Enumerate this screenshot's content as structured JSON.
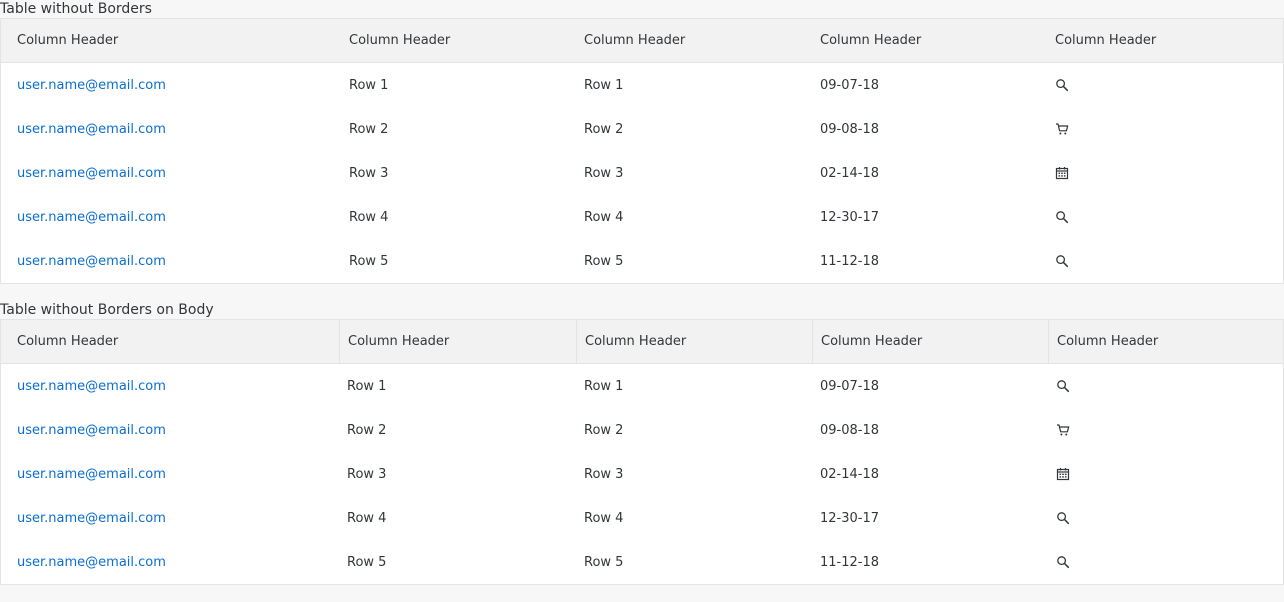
{
  "tables": [
    {
      "title": "Table without Borders",
      "headers": [
        "Column Header",
        "Column Header",
        "Column Header",
        "Column Header",
        "Column Header"
      ],
      "rows": [
        {
          "email": "user.name@email.com",
          "col2": "Row 1",
          "col3": "Row 1",
          "date": "09-07-18",
          "icon": "search-icon"
        },
        {
          "email": "user.name@email.com",
          "col2": "Row 2",
          "col3": "Row 2",
          "date": "09-08-18",
          "icon": "cart-icon"
        },
        {
          "email": "user.name@email.com",
          "col2": "Row 3",
          "col3": "Row 3",
          "date": "02-14-18",
          "icon": "calendar-icon"
        },
        {
          "email": "user.name@email.com",
          "col2": "Row 4",
          "col3": "Row 4",
          "date": "12-30-17",
          "icon": "search-icon"
        },
        {
          "email": "user.name@email.com",
          "col2": "Row 5",
          "col3": "Row 5",
          "date": "11-12-18",
          "icon": "search-icon"
        }
      ]
    },
    {
      "title": "Table without Borders on Body",
      "headers": [
        "Column Header",
        "Column Header",
        "Column Header",
        "Column Header",
        "Column Header"
      ],
      "rows": [
        {
          "email": "user.name@email.com",
          "col2": "Row 1",
          "col3": "Row 1",
          "date": "09-07-18",
          "icon": "search-icon"
        },
        {
          "email": "user.name@email.com",
          "col2": "Row 2",
          "col3": "Row 2",
          "date": "09-08-18",
          "icon": "cart-icon"
        },
        {
          "email": "user.name@email.com",
          "col2": "Row 3",
          "col3": "Row 3",
          "date": "02-14-18",
          "icon": "calendar-icon"
        },
        {
          "email": "user.name@email.com",
          "col2": "Row 4",
          "col3": "Row 4",
          "date": "12-30-17",
          "icon": "search-icon"
        },
        {
          "email": "user.name@email.com",
          "col2": "Row 5",
          "col3": "Row 5",
          "date": "11-12-18",
          "icon": "search-icon"
        }
      ]
    }
  ],
  "colors": {
    "link": "#0a6ed1",
    "header_bg": "#f2f2f2",
    "border": "#e4e4e4",
    "text": "#32363a",
    "page_bg": "#f7f7f7"
  }
}
